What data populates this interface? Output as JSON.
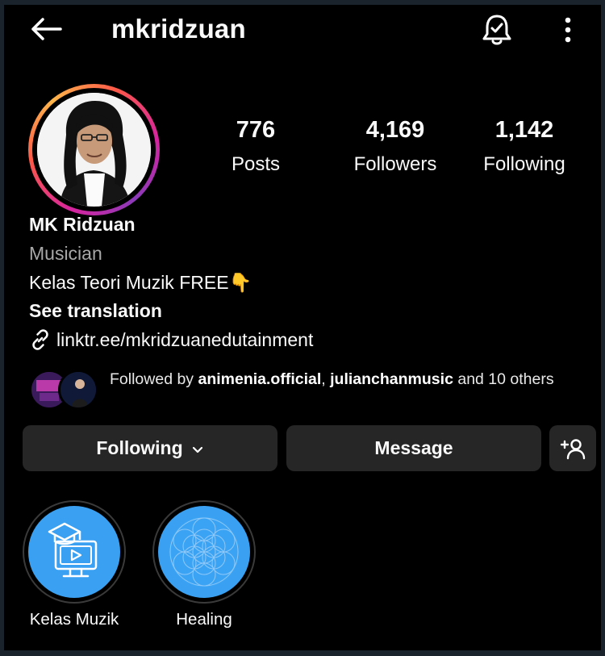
{
  "header": {
    "username": "mkridzuan",
    "back_icon": "back-arrow-icon",
    "bell_icon": "notification-bell-icon",
    "more_icon": "more-vertical-icon"
  },
  "stats": {
    "posts": {
      "value": "776",
      "label": "Posts"
    },
    "followers": {
      "value": "4,169",
      "label": "Followers"
    },
    "following": {
      "value": "1,142",
      "label": "Following"
    }
  },
  "profile": {
    "display_name": "MK Ridzuan",
    "category": "Musician",
    "bio": "Kelas Teori Muzik FREE👇",
    "see_translation": "See translation",
    "link": "linktr.ee/mkridzuanedutainment",
    "story_ring_colors": [
      "#d6249f",
      "#fd5949",
      "#fdb64a",
      "#8a3ab9"
    ]
  },
  "followed_by": {
    "prefix": "Followed by",
    "user1": "animenia.official",
    "sep": ",",
    "user2": "julianchanmusic",
    "suffix": "and 10 others"
  },
  "actions": {
    "following_label": "Following",
    "message_label": "Message",
    "suggest_icon": "add-person-icon"
  },
  "highlights": [
    {
      "label": "Kelas Muzik",
      "icon": "online-class-icon"
    },
    {
      "label": "Healing",
      "icon": "flower-of-life-icon"
    }
  ],
  "colors": {
    "background": "#000000",
    "button": "#262626",
    "highlight": "#3aa1f2",
    "secondary_text": "#a8a8a8"
  }
}
